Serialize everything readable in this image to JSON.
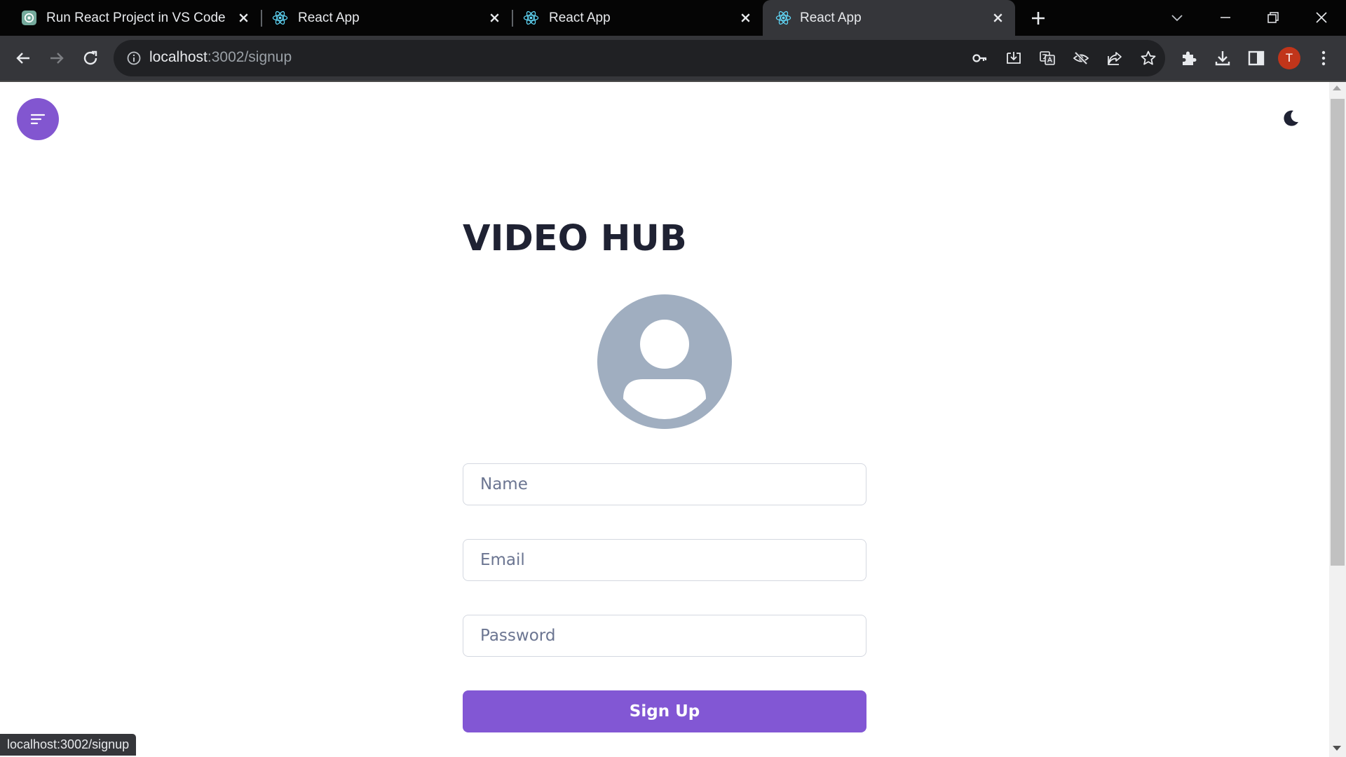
{
  "browser": {
    "tabs": [
      {
        "title": "Run React Project in VS Code",
        "icon": "chatgpt-icon",
        "active": false
      },
      {
        "title": "React App",
        "icon": "react-icon",
        "active": false
      },
      {
        "title": "React App",
        "icon": "react-icon",
        "active": false
      },
      {
        "title": "React App",
        "icon": "react-icon",
        "active": true
      }
    ],
    "url_host": "localhost",
    "url_rest": ":3002/signup",
    "profile_initial": "T",
    "status_url": "localhost:3002/signup"
  },
  "page": {
    "brand_title": "VIDEO HUB",
    "form": {
      "name_placeholder": "Name",
      "email_placeholder": "Email",
      "password_placeholder": "Password",
      "submit_label": "Sign Up"
    }
  },
  "colors": {
    "accent": "#8257d4",
    "title_text": "#1f2233",
    "avatar": "#a0aec0"
  }
}
